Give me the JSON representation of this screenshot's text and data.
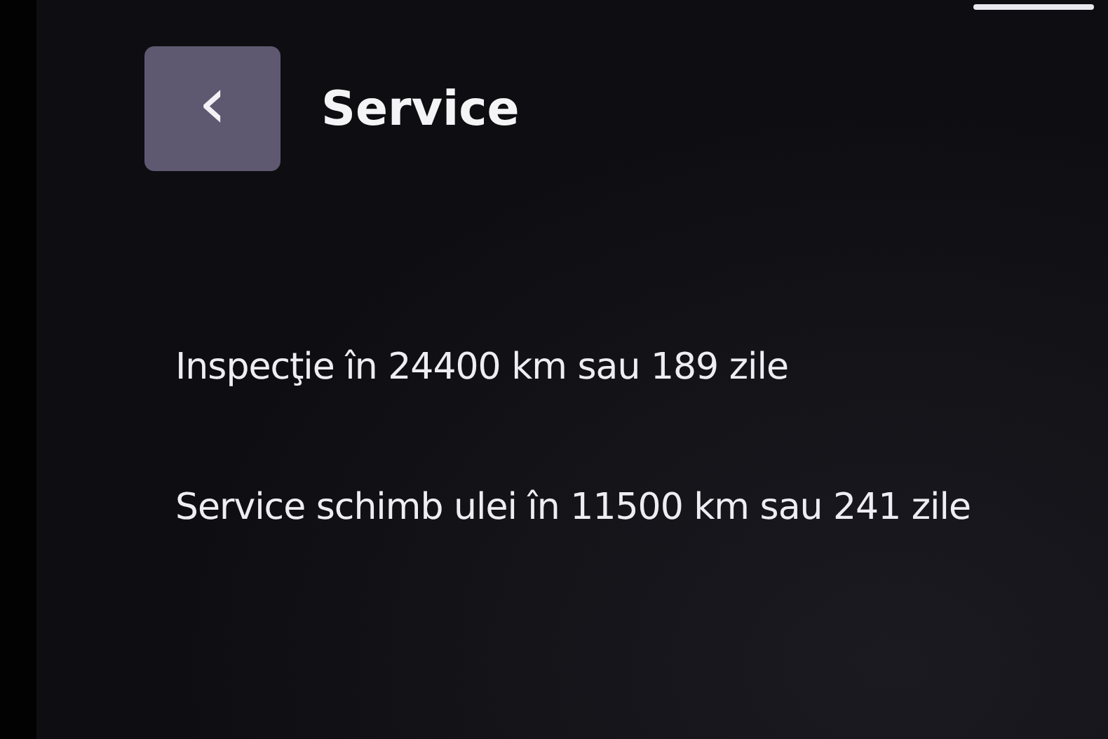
{
  "header": {
    "back_icon": "‹",
    "title": "Service"
  },
  "messages": [
    "Inspecţie în 24400 km sau 189 zile",
    "Service schimb ulei în 11500 km sau 241 zile"
  ]
}
